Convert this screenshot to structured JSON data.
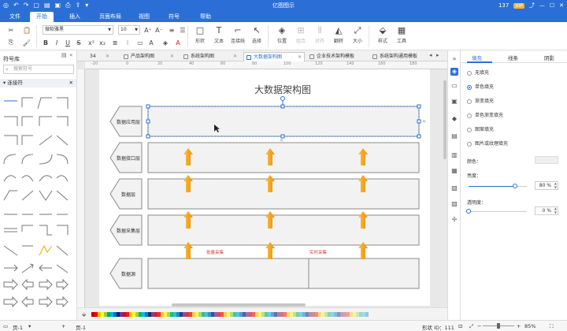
{
  "app": {
    "title": "亿图图示",
    "user_badge": "137",
    "vip": "VIP"
  },
  "menu": {
    "items": [
      "文件",
      "开始",
      "插入",
      "页面布局",
      "视图",
      "符号",
      "帮助"
    ],
    "active": "开始"
  },
  "ribbon": {
    "font_name": "微软雅黑",
    "font_size": "10",
    "tools": {
      "shape": "形状",
      "text": "文本",
      "connector": "连接线",
      "select": "选择",
      "position": "位置",
      "group": "组合",
      "align": "对齐",
      "rotate": "翻转",
      "size": "大小",
      "style": "样式",
      "tools": "工具"
    }
  },
  "library": {
    "title": "符号库",
    "search_placeholder": "搜索符号",
    "category": "连接符"
  },
  "tabs": [
    {
      "label": "34",
      "active": false
    },
    {
      "label": "产品架构图",
      "active": false
    },
    {
      "label": "系统架构图",
      "active": false
    },
    {
      "label": "大数据架构图",
      "active": true
    },
    {
      "label": "企业技术架构模板",
      "active": false
    },
    {
      "label": "系统架构通用模板",
      "active": false
    }
  ],
  "diagram": {
    "title": "大数据架构图",
    "layers": [
      "数据应用层",
      "数据接口层",
      "数据层",
      "数据采集层",
      "数据源"
    ],
    "annotations": [
      "批量采集",
      "实时采集"
    ]
  },
  "right_panel": {
    "tabs": [
      "填充",
      "线条",
      "阴影"
    ],
    "active_tab": "填充",
    "fill_options": [
      "无填充",
      "单色填充",
      "渐变填充",
      "单色渐变填充",
      "图案填充",
      "图片或纹理填充"
    ],
    "selected_fill": "单色填充",
    "color_label": "颜色：",
    "brightness_label": "亮度：",
    "brightness_value": "80 %",
    "brightness_fraction": 0.8,
    "transparency_label": "透明度：",
    "transparency_value": "0 %",
    "transparency_fraction": 0.0
  },
  "status": {
    "page_label": "页-1",
    "page_tab": "页-1",
    "shape_id": "形状 ID：111",
    "zoom": "85%"
  },
  "colors": {
    "accent": "#2b6fd6",
    "arrow": "#f5b21f",
    "annotation": "#e03a3a",
    "layer_fill": "#f2f2f2",
    "layer_stroke": "#8a8a8a"
  }
}
